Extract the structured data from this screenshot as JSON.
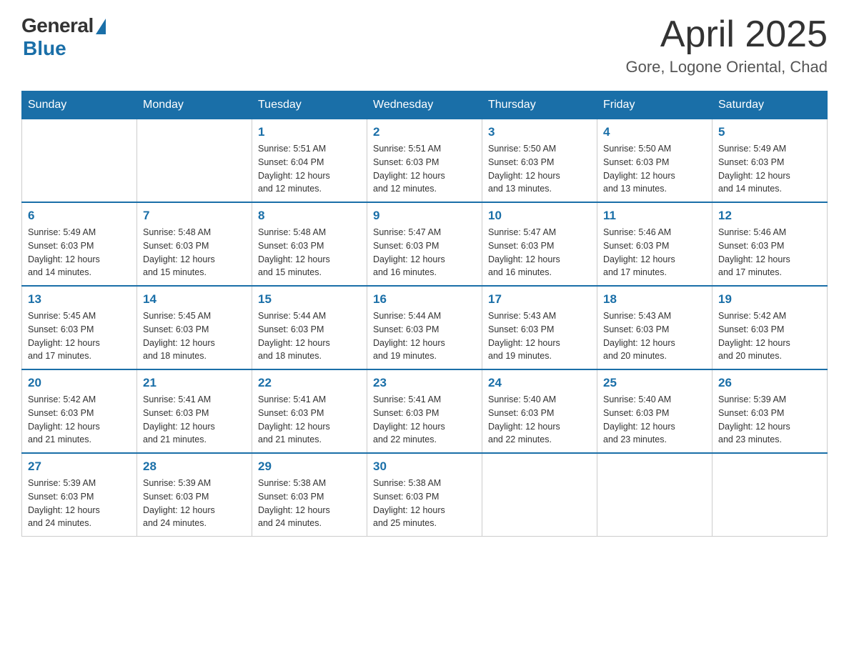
{
  "header": {
    "logo_general": "General",
    "logo_blue": "Blue",
    "month_title": "April 2025",
    "location": "Gore, Logone Oriental, Chad"
  },
  "days_of_week": [
    "Sunday",
    "Monday",
    "Tuesday",
    "Wednesday",
    "Thursday",
    "Friday",
    "Saturday"
  ],
  "weeks": [
    [
      {
        "day": "",
        "info": ""
      },
      {
        "day": "",
        "info": ""
      },
      {
        "day": "1",
        "info": "Sunrise: 5:51 AM\nSunset: 6:04 PM\nDaylight: 12 hours\nand 12 minutes."
      },
      {
        "day": "2",
        "info": "Sunrise: 5:51 AM\nSunset: 6:03 PM\nDaylight: 12 hours\nand 12 minutes."
      },
      {
        "day": "3",
        "info": "Sunrise: 5:50 AM\nSunset: 6:03 PM\nDaylight: 12 hours\nand 13 minutes."
      },
      {
        "day": "4",
        "info": "Sunrise: 5:50 AM\nSunset: 6:03 PM\nDaylight: 12 hours\nand 13 minutes."
      },
      {
        "day": "5",
        "info": "Sunrise: 5:49 AM\nSunset: 6:03 PM\nDaylight: 12 hours\nand 14 minutes."
      }
    ],
    [
      {
        "day": "6",
        "info": "Sunrise: 5:49 AM\nSunset: 6:03 PM\nDaylight: 12 hours\nand 14 minutes."
      },
      {
        "day": "7",
        "info": "Sunrise: 5:48 AM\nSunset: 6:03 PM\nDaylight: 12 hours\nand 15 minutes."
      },
      {
        "day": "8",
        "info": "Sunrise: 5:48 AM\nSunset: 6:03 PM\nDaylight: 12 hours\nand 15 minutes."
      },
      {
        "day": "9",
        "info": "Sunrise: 5:47 AM\nSunset: 6:03 PM\nDaylight: 12 hours\nand 16 minutes."
      },
      {
        "day": "10",
        "info": "Sunrise: 5:47 AM\nSunset: 6:03 PM\nDaylight: 12 hours\nand 16 minutes."
      },
      {
        "day": "11",
        "info": "Sunrise: 5:46 AM\nSunset: 6:03 PM\nDaylight: 12 hours\nand 17 minutes."
      },
      {
        "day": "12",
        "info": "Sunrise: 5:46 AM\nSunset: 6:03 PM\nDaylight: 12 hours\nand 17 minutes."
      }
    ],
    [
      {
        "day": "13",
        "info": "Sunrise: 5:45 AM\nSunset: 6:03 PM\nDaylight: 12 hours\nand 17 minutes."
      },
      {
        "day": "14",
        "info": "Sunrise: 5:45 AM\nSunset: 6:03 PM\nDaylight: 12 hours\nand 18 minutes."
      },
      {
        "day": "15",
        "info": "Sunrise: 5:44 AM\nSunset: 6:03 PM\nDaylight: 12 hours\nand 18 minutes."
      },
      {
        "day": "16",
        "info": "Sunrise: 5:44 AM\nSunset: 6:03 PM\nDaylight: 12 hours\nand 19 minutes."
      },
      {
        "day": "17",
        "info": "Sunrise: 5:43 AM\nSunset: 6:03 PM\nDaylight: 12 hours\nand 19 minutes."
      },
      {
        "day": "18",
        "info": "Sunrise: 5:43 AM\nSunset: 6:03 PM\nDaylight: 12 hours\nand 20 minutes."
      },
      {
        "day": "19",
        "info": "Sunrise: 5:42 AM\nSunset: 6:03 PM\nDaylight: 12 hours\nand 20 minutes."
      }
    ],
    [
      {
        "day": "20",
        "info": "Sunrise: 5:42 AM\nSunset: 6:03 PM\nDaylight: 12 hours\nand 21 minutes."
      },
      {
        "day": "21",
        "info": "Sunrise: 5:41 AM\nSunset: 6:03 PM\nDaylight: 12 hours\nand 21 minutes."
      },
      {
        "day": "22",
        "info": "Sunrise: 5:41 AM\nSunset: 6:03 PM\nDaylight: 12 hours\nand 21 minutes."
      },
      {
        "day": "23",
        "info": "Sunrise: 5:41 AM\nSunset: 6:03 PM\nDaylight: 12 hours\nand 22 minutes."
      },
      {
        "day": "24",
        "info": "Sunrise: 5:40 AM\nSunset: 6:03 PM\nDaylight: 12 hours\nand 22 minutes."
      },
      {
        "day": "25",
        "info": "Sunrise: 5:40 AM\nSunset: 6:03 PM\nDaylight: 12 hours\nand 23 minutes."
      },
      {
        "day": "26",
        "info": "Sunrise: 5:39 AM\nSunset: 6:03 PM\nDaylight: 12 hours\nand 23 minutes."
      }
    ],
    [
      {
        "day": "27",
        "info": "Sunrise: 5:39 AM\nSunset: 6:03 PM\nDaylight: 12 hours\nand 24 minutes."
      },
      {
        "day": "28",
        "info": "Sunrise: 5:39 AM\nSunset: 6:03 PM\nDaylight: 12 hours\nand 24 minutes."
      },
      {
        "day": "29",
        "info": "Sunrise: 5:38 AM\nSunset: 6:03 PM\nDaylight: 12 hours\nand 24 minutes."
      },
      {
        "day": "30",
        "info": "Sunrise: 5:38 AM\nSunset: 6:03 PM\nDaylight: 12 hours\nand 25 minutes."
      },
      {
        "day": "",
        "info": ""
      },
      {
        "day": "",
        "info": ""
      },
      {
        "day": "",
        "info": ""
      }
    ]
  ]
}
